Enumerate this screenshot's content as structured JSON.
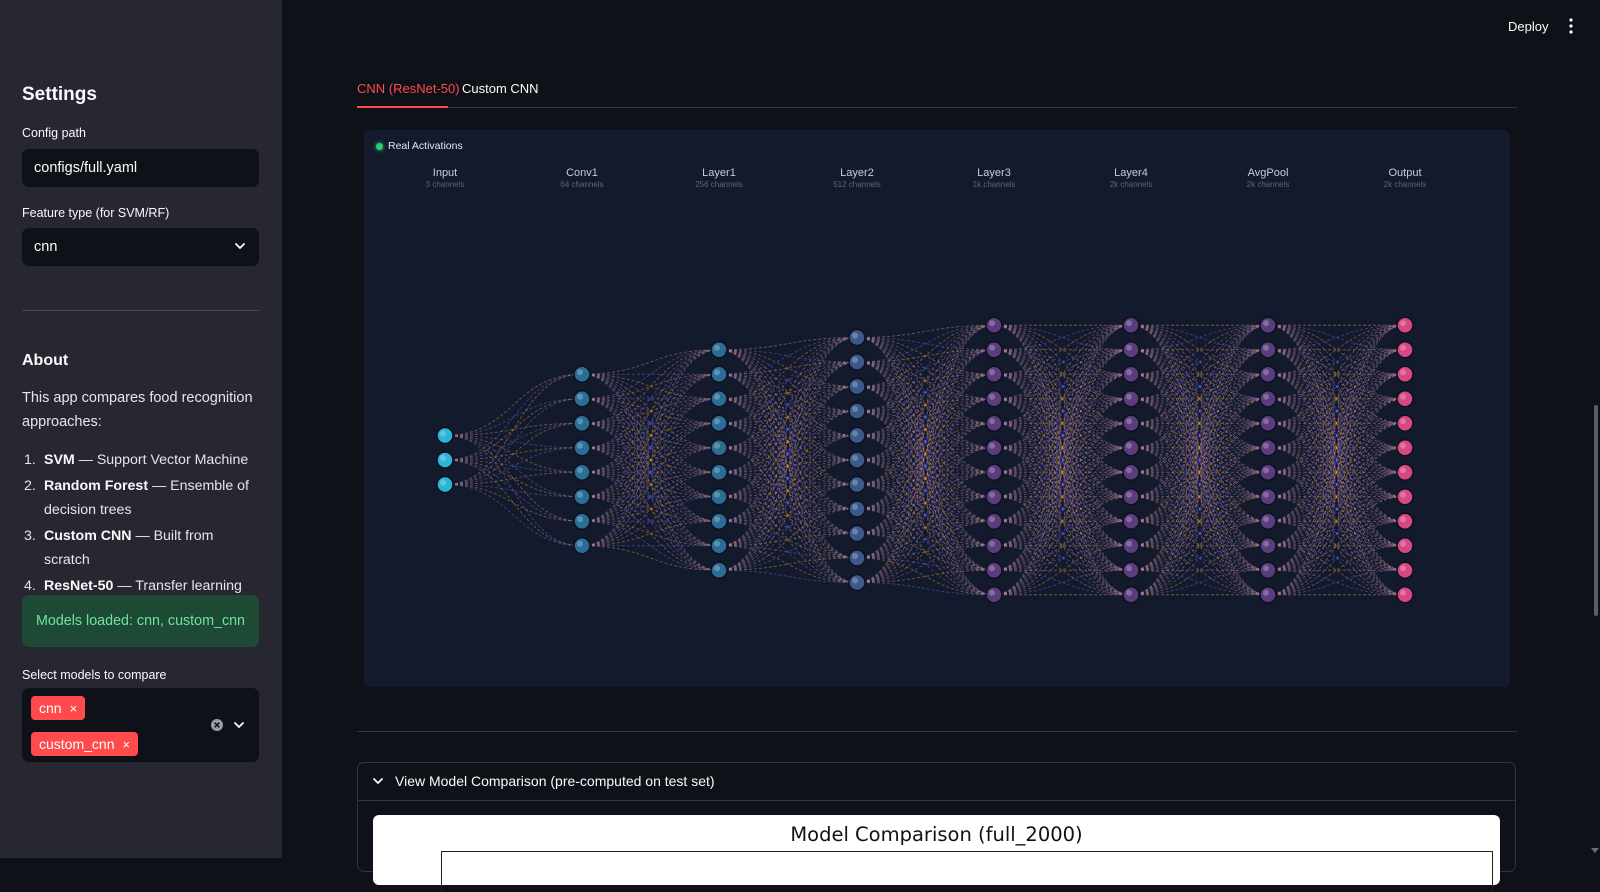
{
  "header": {
    "deploy_label": "Deploy",
    "menu_icon": "kebab-menu-icon"
  },
  "sidebar": {
    "title": "Settings",
    "config_path": {
      "label": "Config path",
      "value": "configs/full.yaml"
    },
    "feature_type": {
      "label": "Feature type (for SVM/RF)",
      "value": "cnn"
    },
    "about": {
      "heading": "About",
      "intro": "This app compares food recognition approaches:",
      "items": [
        {
          "num": "1.",
          "name": "SVM",
          "desc": " — Support Vector Machine"
        },
        {
          "num": "2.",
          "name": "Random Forest",
          "desc": " — Ensemble of decision trees"
        },
        {
          "num": "3.",
          "name": "Custom CNN",
          "desc": " — Built from scratch"
        },
        {
          "num": "4.",
          "name": "ResNet-50",
          "desc": " — Transfer learning"
        }
      ]
    },
    "status": "Models loaded: cnn, custom_cnn",
    "compare": {
      "label": "Select models to compare",
      "chips": [
        "cnn",
        "custom_cnn"
      ],
      "chip_remove": "×"
    }
  },
  "tabs": [
    {
      "label": "CNN (ResNet-50)",
      "active": true
    },
    {
      "label": "Custom CNN",
      "active": false
    }
  ],
  "network": {
    "badge": "Real Activations",
    "layers": [
      {
        "name": "Input",
        "channels": "3 channels",
        "nodes": 3,
        "color": "#2bb5d6"
      },
      {
        "name": "Conv1",
        "channels": "64 channels",
        "nodes": 8,
        "color": "#2a6e96"
      },
      {
        "name": "Layer1",
        "channels": "256 channels",
        "nodes": 10,
        "color": "#2a6e96"
      },
      {
        "name": "Layer2",
        "channels": "512 channels",
        "nodes": 11,
        "color": "#3b5a8a"
      },
      {
        "name": "Layer3",
        "channels": "1k channels",
        "nodes": 12,
        "color": "#5b3d7e"
      },
      {
        "name": "Layer4",
        "channels": "2k channels",
        "nodes": 12,
        "color": "#5b3d7e"
      },
      {
        "name": "AvgPool",
        "channels": "2k channels",
        "nodes": 12,
        "color": "#5b3d7e"
      },
      {
        "name": "Output",
        "channels": "2k channels",
        "nodes": 12,
        "color": "#d6487f"
      }
    ],
    "edge_colors": [
      "#f0a050",
      "#7b6cf0"
    ]
  },
  "comparison": {
    "expander_label": "View Model Comparison (pre-computed on test set)",
    "plot_title": "Model Comparison (full_2000)"
  }
}
